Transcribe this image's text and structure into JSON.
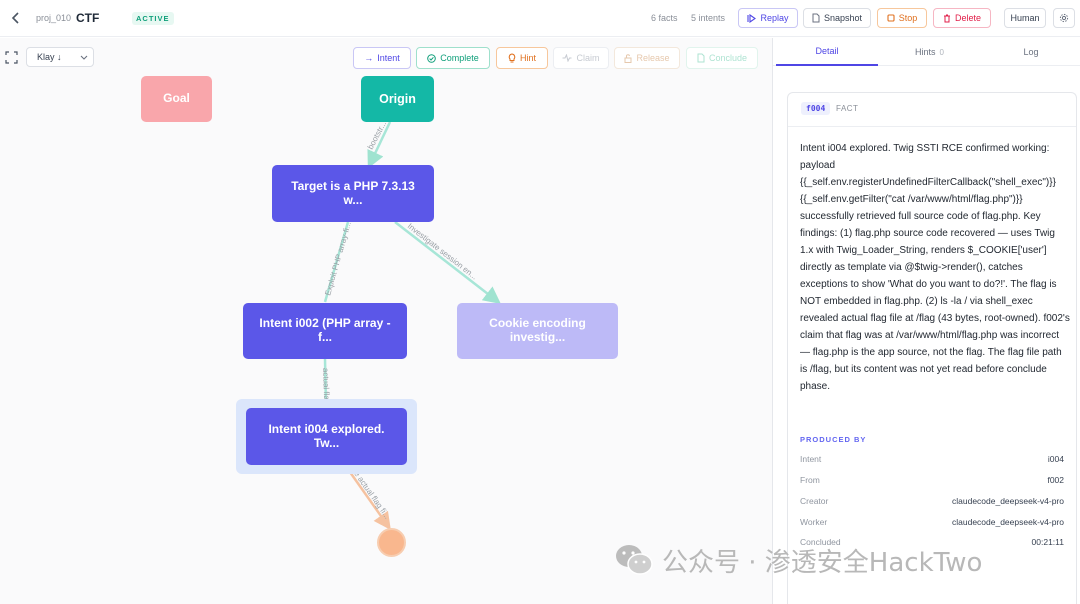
{
  "header": {
    "project": "proj_010",
    "title": "CTF",
    "status": "ACTIVE",
    "facts": "6 facts",
    "intents": "5 intents",
    "buttons": {
      "replay": "Replay",
      "snapshot": "Snapshot",
      "stop": "Stop",
      "delete": "Delete",
      "human": "Human"
    }
  },
  "canvas": {
    "layout": "Klay ↓",
    "actions": {
      "intent": "Intent",
      "complete": "Complete",
      "hint": "Hint",
      "claim": "Claim",
      "release": "Release",
      "conclude": "Conclude"
    },
    "nodes": {
      "goal": "Goal",
      "origin": "Origin",
      "target": "Target is a PHP 7.3.13 w...",
      "i002": "Intent i002 (PHP array -f...",
      "cookie": "Cookie encoding investig...",
      "i004": "Intent i004 explored. Tw..."
    },
    "edges": {
      "origin_target": "bootstr...",
      "target_i002": "Exploit PHP array-fi...",
      "target_cookie": "Investigate session en...",
      "i002_i004": "actual flag...",
      "i004_end": "the actual flag fi..."
    }
  },
  "panel": {
    "tabs": {
      "detail": "Detail",
      "hints": "Hints",
      "hints_count": "0",
      "log": "Log"
    },
    "fact": {
      "id": "f004",
      "type": "FACT",
      "body": "Intent i004 explored. Twig SSTI RCE confirmed working: payload {{_self.env.registerUndefinedFilterCallback(\"shell_exec\")}}{{_self.env.getFilter(\"cat /var/www/html/flag.php\")}} successfully retrieved full source code of flag.php. Key findings: (1) flag.php source code recovered — uses Twig 1.x with Twig_Loader_String, renders $_COOKIE['user'] directly as template via @$twig->render(), catches exceptions to show 'What do you want to do?!'. The flag is NOT embedded in flag.php. (2) ls -la / via shell_exec revealed actual flag file at /flag (43 bytes, root-owned). f002's claim that flag was at /var/www/html/flag.php was incorrect — flag.php is the app source, not the flag. The flag file path is /flag, but its content was not yet read before conclude phase.",
      "produced_by_label": "PRODUCED BY",
      "meta": [
        {
          "key": "Intent",
          "value": "i004"
        },
        {
          "key": "From",
          "value": "f002"
        },
        {
          "key": "Creator",
          "value": "claudecode_deepseek-v4-pro"
        },
        {
          "key": "Worker",
          "value": "claudecode_deepseek-v4-pro"
        },
        {
          "key": "Concluded",
          "value": "00:21:11"
        }
      ]
    }
  },
  "watermark": "公众号 · 渗透安全HackTwo",
  "colors": {
    "accent": "#4f46e5",
    "origin": "#14b8a6",
    "goal": "#f9a6ab",
    "intent": "#5b57e8",
    "pending": "#bdbaf7",
    "end": "#f9b78e"
  }
}
